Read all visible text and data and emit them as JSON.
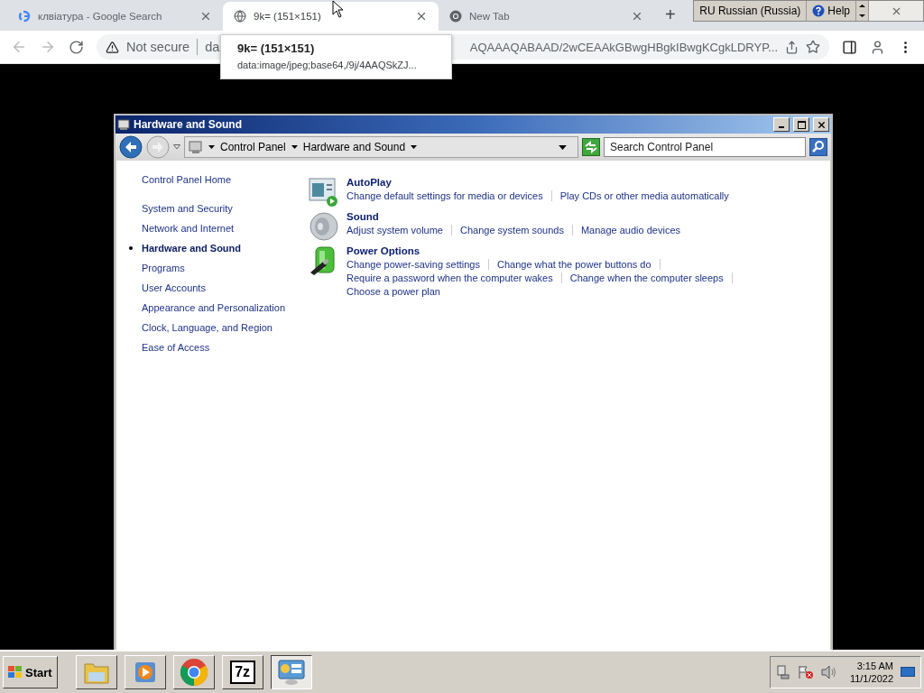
{
  "browser": {
    "tabs": [
      {
        "title": "клвіатура - Google Search",
        "kind": "google",
        "selected": false
      },
      {
        "title": "9k= (151×151)",
        "kind": "globe",
        "selected": true
      },
      {
        "title": "New Tab",
        "kind": "chrome",
        "selected": false
      }
    ],
    "new_tab": "+",
    "address": {
      "security": "Not secure",
      "url_start": "da",
      "url_end": "AQAAAQABAAD/2wCEAAkGBwgHBgkIBwgKCgkLDRYP..."
    },
    "tooltip": {
      "title": "9k= (151×151)",
      "subtitle": "data:image/jpeg;base64,/9j/4AAQSkZJ..."
    }
  },
  "language_bar": {
    "language": "RU Russian (Russia)",
    "help": "Help"
  },
  "window": {
    "title": "Hardware and Sound",
    "breadcrumbs": [
      "Control Panel",
      "Hardware and Sound"
    ],
    "search": {
      "placeholder": "Search Control Panel"
    },
    "sidebar": [
      {
        "label": "Control Panel Home",
        "selected": false,
        "kind": "home"
      },
      {
        "label": "System and Security",
        "selected": false,
        "kind": "item"
      },
      {
        "label": "Network and Internet",
        "selected": false,
        "kind": "item"
      },
      {
        "label": "Hardware and Sound",
        "selected": true,
        "kind": "item"
      },
      {
        "label": "Programs",
        "selected": false,
        "kind": "item"
      },
      {
        "label": "User Accounts",
        "selected": false,
        "kind": "item"
      },
      {
        "label": "Appearance and Personalization",
        "selected": false,
        "kind": "item"
      },
      {
        "label": "Clock, Language, and Region",
        "selected": false,
        "kind": "item"
      },
      {
        "label": "Ease of Access",
        "selected": false,
        "kind": "item"
      }
    ],
    "categories": [
      {
        "title": "AutoPlay",
        "kind": "autoplay",
        "link_rows": [
          [
            "Change default settings for media or devices",
            "Play CDs or other media automatically"
          ]
        ]
      },
      {
        "title": "Sound",
        "kind": "sound",
        "link_rows": [
          [
            "Adjust system volume",
            "Change system sounds",
            "Manage audio devices"
          ]
        ]
      },
      {
        "title": "Power Options",
        "kind": "power",
        "link_rows": [
          [
            "Change power-saving settings",
            "Change what the power buttons do"
          ],
          [
            "Require a password when the computer wakes",
            "Change when the computer sleeps"
          ],
          [
            "Choose a power plan"
          ]
        ]
      }
    ]
  },
  "taskbar": {
    "start": "Start",
    "apps": [
      {
        "kind": "folder",
        "selected": false
      },
      {
        "kind": "media",
        "selected": false
      },
      {
        "kind": "chrome",
        "selected": false
      },
      {
        "kind": "archive",
        "label": "7z",
        "selected": false
      },
      {
        "kind": "control",
        "selected": true
      }
    ],
    "time": "3:15 AM",
    "date": "11/1/2022"
  }
}
